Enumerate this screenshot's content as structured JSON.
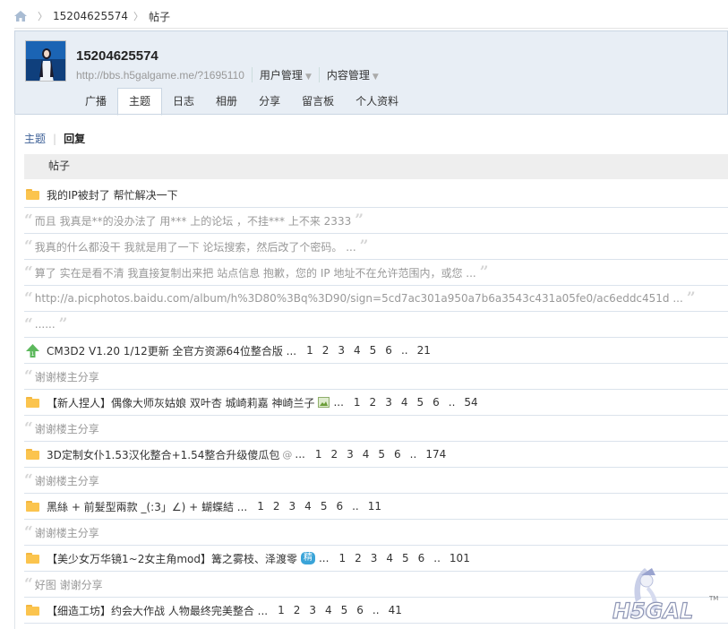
{
  "breadcrumb": {
    "user": "15204625574",
    "section": "帖子"
  },
  "profile": {
    "username": "15204625574",
    "url": "http://bbs.h5galgame.me/?1695110",
    "menu_user": "用户管理",
    "menu_content": "内容管理"
  },
  "tabs": [
    "广播",
    "主题",
    "日志",
    "相册",
    "分享",
    "留言板",
    "个人资料"
  ],
  "subtabs": {
    "topics": "主题",
    "replies": "回复"
  },
  "table_header": "帖子",
  "rows": [
    {
      "kind": "thread",
      "icon": "folder-icon",
      "title": "我的IP被封了 帮忙解决一下",
      "pages": []
    },
    {
      "kind": "reply",
      "text": "而且 我真是**的没办法了 用*** 上的论坛 ，不挂*** 上不来 2333"
    },
    {
      "kind": "reply",
      "text": "我真的什么都没干 我就是用了一下 论坛搜索，然后改了个密码。 ..."
    },
    {
      "kind": "reply",
      "text": "算了 实在是看不清 我直接复制出来把 站点信息 抱歉，您的 IP 地址不在允许范围内，或您 ..."
    },
    {
      "kind": "reply",
      "text": "http://a.picphotos.baidu.com/album/h%3D80%3Bq%3D90/sign=5cd7ac301a950a7b6a3543c431a05fe0/ac6eddc451d ..."
    },
    {
      "kind": "reply",
      "text": "......"
    },
    {
      "kind": "thread",
      "icon": "up-arrow-icon",
      "title": "CM3D2 V1.20 1/12更新 全官方资源64位整合版 ...",
      "pages": [
        "1",
        "2",
        "3",
        "4",
        "5",
        "6",
        "..",
        "21"
      ]
    },
    {
      "kind": "reply",
      "text": "谢谢楼主分享"
    },
    {
      "kind": "thread",
      "icon": "folder-icon",
      "title": "【新人捏人】偶像大师灰姑娘 双叶杏 城崎莉嘉 神崎兰子",
      "after": "...",
      "badge": "image-icon",
      "pages": [
        "1",
        "2",
        "3",
        "4",
        "5",
        "6",
        "..",
        "54"
      ]
    },
    {
      "kind": "reply",
      "text": "谢谢楼主分享"
    },
    {
      "kind": "thread",
      "icon": "folder-icon",
      "title": "3D定制女仆1.53汉化整合+1.54整合升级傻瓜包",
      "badge": "attachment-icon",
      "after": "...",
      "pages": [
        "1",
        "2",
        "3",
        "4",
        "5",
        "6",
        "..",
        "174"
      ]
    },
    {
      "kind": "reply",
      "text": "谢谢楼主分享"
    },
    {
      "kind": "thread",
      "icon": "folder-icon",
      "title": "黑絲 + 前髮型兩款 _(:3」∠) + 蝴蝶結 ...",
      "pages": [
        "1",
        "2",
        "3",
        "4",
        "5",
        "6",
        "..",
        "11"
      ]
    },
    {
      "kind": "reply",
      "text": "谢谢楼主分享"
    },
    {
      "kind": "thread",
      "icon": "folder-icon",
      "title": "【美少女万华镜1~2女主角mod】篝之雾枝、泽渡零",
      "badge_text": "精",
      "after": "...",
      "pages": [
        "1",
        "2",
        "3",
        "4",
        "5",
        "6",
        "..",
        "101"
      ]
    },
    {
      "kind": "reply",
      "text": "好图 谢谢分享"
    },
    {
      "kind": "thread",
      "icon": "folder-icon",
      "title": "【细造工坊】约会大作战 人物最终完美整合 ...",
      "pages": [
        "1",
        "2",
        "3",
        "4",
        "5",
        "6",
        "..",
        "41"
      ]
    }
  ],
  "watermark": {
    "text": "H5GAL",
    "tm": "TM"
  },
  "colors": {
    "link_blue": "#3c5f96",
    "folder": "#fbc44e",
    "profile_bg": "#e8eef5",
    "row_border": "#dbe3ec"
  }
}
